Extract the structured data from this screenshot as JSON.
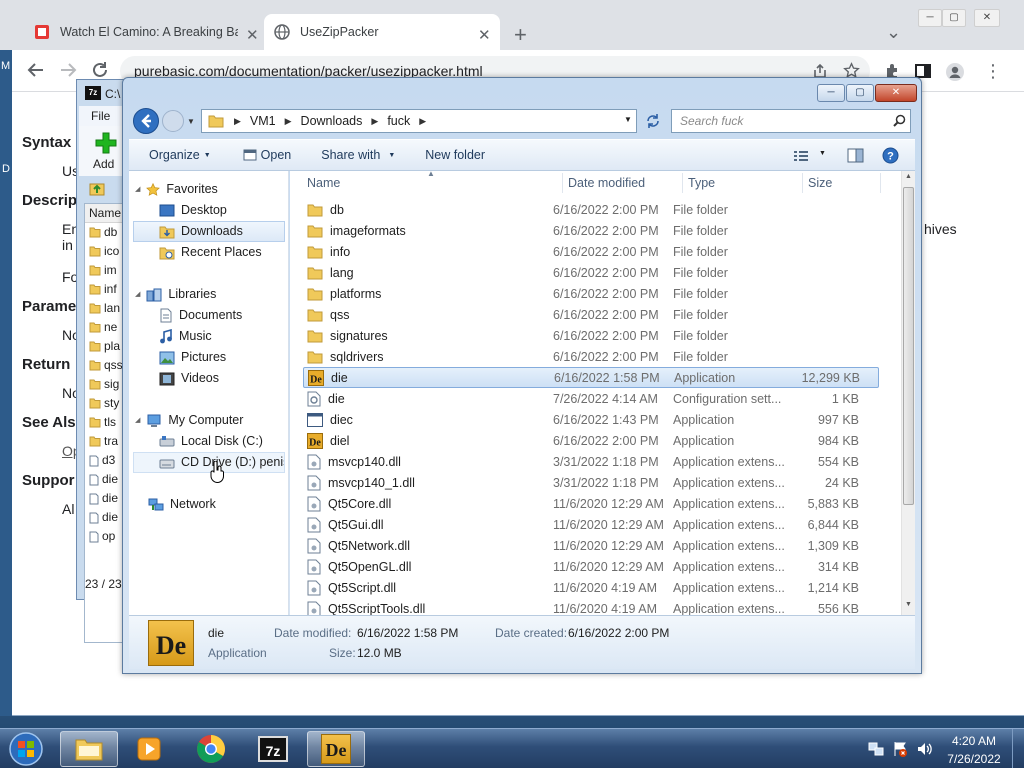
{
  "browser": {
    "tabs": [
      {
        "title": "Watch El Camino: A Breaking Bad",
        "icon": "tv-icon"
      },
      {
        "title": "UseZipPacker",
        "icon": "globe-icon"
      }
    ],
    "new_tab": "+",
    "tab_search": "⌄",
    "window_controls": {
      "minimize": "─",
      "maximize": "▢",
      "close": "✕"
    },
    "url": "purebasic.com/documentation/packer/usezippacker.html",
    "page_partial": {
      "headings": [
        "Syntax",
        "Descrip",
        "Parame",
        "Return",
        "See Als",
        "Suppor"
      ],
      "sub": [
        "Us",
        "En",
        "in",
        "Fo",
        "No",
        "No",
        "Op",
        "Al"
      ],
      "right_text": "hives",
      "left_edge": [
        "M",
        "D"
      ]
    }
  },
  "sevenzip": {
    "title": "C:\\",
    "menu": [
      "File"
    ],
    "add_label": "Add",
    "list_header": "Name",
    "rows": [
      "db",
      "ico",
      "im",
      "inf",
      "lan",
      "ne",
      "pla",
      "qss",
      "sig",
      "sty",
      "tls",
      "tra",
      "d3",
      "die",
      "die",
      "die",
      "op"
    ],
    "status": "23 / 23"
  },
  "explorer": {
    "breadcrumb": [
      "VM1",
      "Downloads",
      "fuck"
    ],
    "search_placeholder": "Search fuck",
    "commands": {
      "organize": "Organize",
      "open": "Open",
      "share": "Share with",
      "new_folder": "New folder"
    },
    "nav": {
      "favorites": "Favorites",
      "desktop": "Desktop",
      "downloads": "Downloads",
      "recent": "Recent Places",
      "libraries": "Libraries",
      "documents": "Documents",
      "music": "Music",
      "pictures": "Pictures",
      "videos": "Videos",
      "computer": "My Computer",
      "local_disk": "Local Disk (C:)",
      "cd_drive": "CD Drive (D:) penise",
      "network": "Network"
    },
    "columns": {
      "name": "Name",
      "date": "Date modified",
      "type": "Type",
      "size": "Size"
    },
    "files": [
      {
        "name": "db",
        "date": "6/16/2022 2:00 PM",
        "type": "File folder",
        "size": "",
        "icon": "folder-icon"
      },
      {
        "name": "imageformats",
        "date": "6/16/2022 2:00 PM",
        "type": "File folder",
        "size": "",
        "icon": "folder-icon"
      },
      {
        "name": "info",
        "date": "6/16/2022 2:00 PM",
        "type": "File folder",
        "size": "",
        "icon": "folder-icon"
      },
      {
        "name": "lang",
        "date": "6/16/2022 2:00 PM",
        "type": "File folder",
        "size": "",
        "icon": "folder-icon"
      },
      {
        "name": "platforms",
        "date": "6/16/2022 2:00 PM",
        "type": "File folder",
        "size": "",
        "icon": "folder-icon"
      },
      {
        "name": "qss",
        "date": "6/16/2022 2:00 PM",
        "type": "File folder",
        "size": "",
        "icon": "folder-icon"
      },
      {
        "name": "signatures",
        "date": "6/16/2022 2:00 PM",
        "type": "File folder",
        "size": "",
        "icon": "folder-icon"
      },
      {
        "name": "sqldrivers",
        "date": "6/16/2022 2:00 PM",
        "type": "File folder",
        "size": "",
        "icon": "folder-icon"
      },
      {
        "name": "die",
        "date": "6/16/2022 1:58 PM",
        "type": "Application",
        "size": "12,299 KB",
        "icon": "die-app-icon"
      },
      {
        "name": "die",
        "date": "7/26/2022 4:14 AM",
        "type": "Configuration sett...",
        "size": "1 KB",
        "icon": "config-file-icon"
      },
      {
        "name": "diec",
        "date": "6/16/2022 1:43 PM",
        "type": "Application",
        "size": "997 KB",
        "icon": "console-app-icon"
      },
      {
        "name": "diel",
        "date": "6/16/2022 2:00 PM",
        "type": "Application",
        "size": "984 KB",
        "icon": "die-app-icon"
      },
      {
        "name": "msvcp140.dll",
        "date": "3/31/2022 1:18 PM",
        "type": "Application extens...",
        "size": "554 KB",
        "icon": "dll-file-icon"
      },
      {
        "name": "msvcp140_1.dll",
        "date": "3/31/2022 1:18 PM",
        "type": "Application extens...",
        "size": "24 KB",
        "icon": "dll-file-icon"
      },
      {
        "name": "Qt5Core.dll",
        "date": "11/6/2020 12:29 AM",
        "type": "Application extens...",
        "size": "5,883 KB",
        "icon": "dll-file-icon"
      },
      {
        "name": "Qt5Gui.dll",
        "date": "11/6/2020 12:29 AM",
        "type": "Application extens...",
        "size": "6,844 KB",
        "icon": "dll-file-icon"
      },
      {
        "name": "Qt5Network.dll",
        "date": "11/6/2020 12:29 AM",
        "type": "Application extens...",
        "size": "1,309 KB",
        "icon": "dll-file-icon"
      },
      {
        "name": "Qt5OpenGL.dll",
        "date": "11/6/2020 12:29 AM",
        "type": "Application extens...",
        "size": "314 KB",
        "icon": "dll-file-icon"
      },
      {
        "name": "Qt5Script.dll",
        "date": "11/6/2020 4:19 AM",
        "type": "Application extens...",
        "size": "1,214 KB",
        "icon": "dll-file-icon"
      },
      {
        "name": "Qt5ScriptTools.dll",
        "date": "11/6/2020 4:19 AM",
        "type": "Application extens...",
        "size": "556 KB",
        "icon": "dll-file-icon"
      }
    ],
    "details": {
      "name": "die",
      "type": "Application",
      "modified_label": "Date modified:",
      "modified_value": "6/16/2022 1:58 PM",
      "created_label": "Date created:",
      "created_value": "6/16/2022 2:00 PM",
      "size_label": "Size:",
      "size_value": "12.0 MB"
    }
  },
  "taskbar": {
    "time": "4:20 AM",
    "date": "7/26/2022",
    "items": [
      "file-explorer-icon",
      "media-player-icon",
      "chrome-icon",
      "7zip-icon",
      "die-app-icon"
    ],
    "app_labels": {
      "sevenzip": "7z",
      "die": "De"
    }
  },
  "colors": {
    "selection": "#cde0f5",
    "accent": "#3c7fd1",
    "folder": "#f0c95a"
  }
}
